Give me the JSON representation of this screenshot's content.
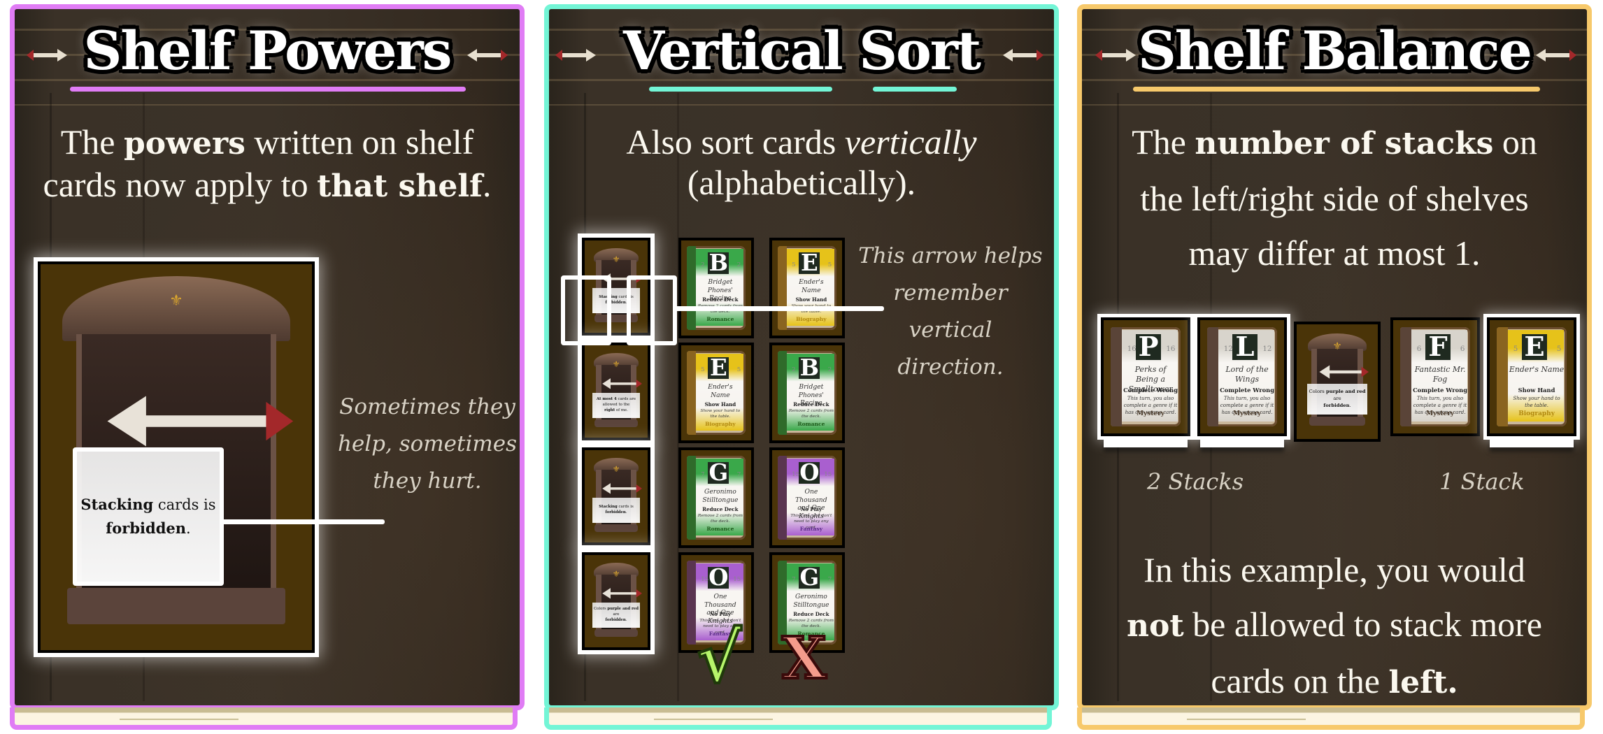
{
  "colors": {
    "panel1_accent": "#e07cf5",
    "panel2_accent": "#73f5d6",
    "panel3_accent": "#f7c96b",
    "check_color": "#b6f56a",
    "cross_color": "#f49c8c"
  },
  "panels": [
    {
      "title": "Shelf Powers",
      "text_parts": [
        "The ",
        "powers",
        " written on shelf",
        "cards now apply to ",
        "that shelf",
        "."
      ],
      "example_card": {
        "type": "shelf",
        "power_bold": "Stacking",
        "power_rest": " cards is",
        "power_bold2": "forbidden",
        "power_end": "."
      },
      "note": [
        "Sometimes they",
        "help, sometimes",
        "they hurt."
      ]
    },
    {
      "title": "Vertical Sort",
      "text_parts": [
        "Also sort cards ",
        "vertically",
        "(alphabetically)."
      ],
      "note": [
        "This arrow helps",
        "remember",
        "vertical",
        "direction."
      ],
      "shelf_cards": [
        {
          "bold": "Stacking",
          "rest": " cards is",
          "bold2": "forbidden",
          "end": "."
        },
        {
          "pre": "",
          "bold": "At most 4",
          "rest": " cards are allowed to the ",
          "bold2": "right",
          "end": " of me."
        },
        {
          "bold": "Stacking",
          "rest": " cards is",
          "bold2": "forbidden",
          "end": "."
        },
        {
          "pre": "Colors ",
          "bold": "purple and red",
          "rest": " are",
          "bold2": "forbidden",
          "end": "."
        }
      ],
      "columns": [
        {
          "verdict": "correct",
          "verdict_icon": "check-mark-icon",
          "verdict_glyph": "√",
          "cards": [
            {
              "letter": "B",
              "title": "Bridget Phones' Recipe",
              "power": "Reduce Deck",
              "desc": "Remove 2 cards from the deck.",
              "genre": "Romance",
              "color": "green",
              "number": "2"
            },
            {
              "letter": "E",
              "title": "Ender's Name",
              "power": "Show Hand",
              "desc": "Show your hand to the table.",
              "genre": "Biography",
              "color": "yellow",
              "number": "5"
            },
            {
              "letter": "G",
              "title": "Geronimo Stilltongue",
              "power": "Reduce Deck",
              "desc": "Remove 2 cards from the deck.",
              "genre": "Romance",
              "color": "green",
              "number": "7"
            },
            {
              "letter": "O",
              "title": "One Thousand and One Knights",
              "power": "No Play",
              "desc": "This turn, you don't need to play any card.",
              "genre": "Fantasy",
              "color": "purple",
              "number": "15"
            }
          ]
        },
        {
          "verdict": "wrong",
          "verdict_icon": "cross-mark-icon",
          "verdict_glyph": "X",
          "cards": [
            {
              "letter": "E",
              "title": "Ender's Name",
              "power": "Show Hand",
              "desc": "Show your hand to the table.",
              "genre": "Biography",
              "color": "yellow",
              "number": "5"
            },
            {
              "letter": "B",
              "title": "Bridget Phones' Recipe",
              "power": "Reduce Deck",
              "desc": "Remove 2 cards from the deck.",
              "genre": "Romance",
              "color": "green",
              "number": "2"
            },
            {
              "letter": "O",
              "title": "One Thousand and One Knights",
              "power": "No Play",
              "desc": "This turn, you don't need to play any card.",
              "genre": "Fantasy",
              "color": "purple",
              "number": "15"
            },
            {
              "letter": "G",
              "title": "Geronimo Stilltongue",
              "power": "Reduce Deck",
              "desc": "Remove 2 cards from the deck.",
              "genre": "Romance",
              "color": "green",
              "number": "7"
            }
          ]
        }
      ]
    },
    {
      "title": "Shelf Balance",
      "text_parts": [
        "The ",
        "number of stacks",
        " on",
        "the left/right side of shelves",
        "may differ at most 1."
      ],
      "row": [
        {
          "letter": "P",
          "title": "Perks of Being a Smalltower",
          "power": "Complete Wrong",
          "desc": "This turn, you also complete a genre if it has one wrong card.",
          "genre": "Mystery",
          "color": "white",
          "number": "16",
          "stacked": true
        },
        {
          "letter": "L",
          "title": "Lord of the Wings",
          "power": "Complete Wrong",
          "desc": "This turn, you also complete a genre if it has one wrong card.",
          "genre": "Mystery",
          "color": "white",
          "number": "12",
          "stacked": true
        },
        {
          "type": "shelf",
          "pre": "Colors ",
          "bold": "purple and red",
          "rest": " are",
          "bold2": "forbidden",
          "end": "."
        },
        {
          "letter": "F",
          "title": "Fantastic Mr. Fog",
          "power": "Complete Wrong",
          "desc": "This turn, you also complete a genre if it has one wrong card.",
          "genre": "Mystery",
          "color": "white",
          "number": "6",
          "stacked": false
        },
        {
          "letter": "E",
          "title": "Ender's Name",
          "power": "Show Hand",
          "desc": "Show your hand to the table.",
          "genre": "Biography",
          "color": "yellow",
          "number": "5",
          "stacked": true
        }
      ],
      "left_label": "2 Stacks",
      "right_label": "1 Stack",
      "footer_parts": [
        "In this example, you would",
        "not",
        " be allowed to stack more",
        "cards on the ",
        "left."
      ]
    }
  ]
}
